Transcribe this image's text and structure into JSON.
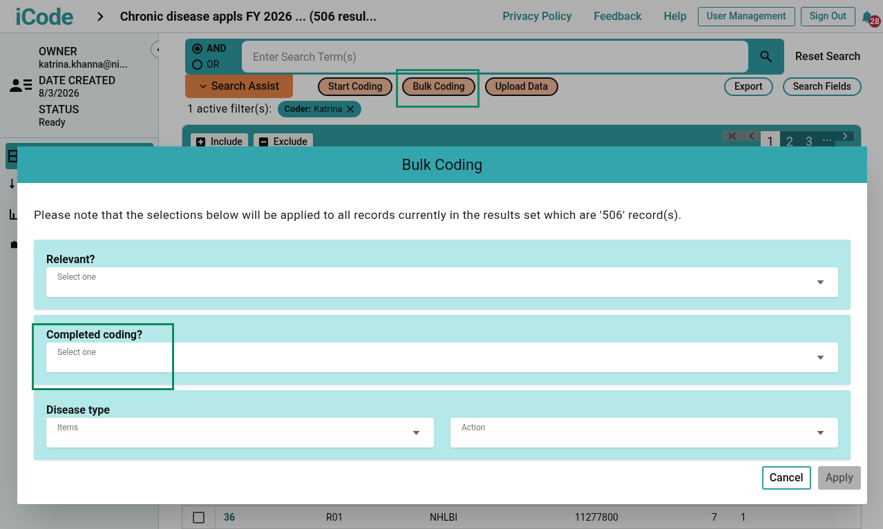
{
  "header": {
    "logo": "iCode",
    "title": "Chronic disease appls FY 2026 ... (506 resul...",
    "links": [
      "Privacy Policy",
      "Feedback",
      "Help"
    ],
    "buttons": [
      "User Management",
      "Sign Out"
    ],
    "notification_count": "28"
  },
  "sidebar": {
    "fields": [
      {
        "label": "OWNER",
        "value": "katrina.khanna@ni..."
      },
      {
        "label": "DATE CREATED",
        "value": "8/3/2026"
      },
      {
        "label": "STATUS",
        "value": "Ready"
      }
    ]
  },
  "search": {
    "operators": [
      {
        "label": "AND",
        "selected": true
      },
      {
        "label": "OR",
        "selected": false
      }
    ],
    "placeholder": "Enter Search Term(s)",
    "reset": "Reset Search",
    "assist": "Search Assist",
    "actions": [
      {
        "label": "Start Coding",
        "highlighted": false
      },
      {
        "label": "Bulk Coding",
        "highlighted": true
      },
      {
        "label": "Upload Data",
        "highlighted": false
      }
    ],
    "tools": [
      "Export",
      "Search Fields"
    ],
    "filter_count": "1 active filter(s):",
    "filters": [
      {
        "key": "Coder:",
        "value": "Katrina"
      }
    ]
  },
  "results": {
    "buttons": [
      {
        "kind": "include",
        "label": "Include"
      },
      {
        "kind": "exclude",
        "label": "Exclude"
      }
    ],
    "pages": [
      {
        "label": "1",
        "selected": true
      },
      {
        "label": "2",
        "selected": false
      },
      {
        "label": "3",
        "selected": false
      }
    ],
    "ellipsis": "...",
    "row": {
      "checked": false,
      "cells": [
        "36",
        "R01",
        "NHLBI",
        "11277800",
        "7",
        "1"
      ]
    }
  },
  "dialog": {
    "title": "Bulk Coding",
    "note": "Please note that the selections below will be applied to all records currently in the results set which are '506' record(s).",
    "sections": [
      {
        "title": "Relevant?",
        "highlighted": false,
        "fields": [
          "Select one"
        ]
      },
      {
        "title": "Completed coding?",
        "highlighted": true,
        "fields": [
          "Select one"
        ]
      },
      {
        "title": "Disease type",
        "highlighted": false,
        "fields": [
          "Items",
          "Action"
        ]
      }
    ],
    "buttons": [
      {
        "label": "Cancel",
        "disabled": false
      },
      {
        "label": "Apply",
        "disabled": true
      }
    ]
  }
}
